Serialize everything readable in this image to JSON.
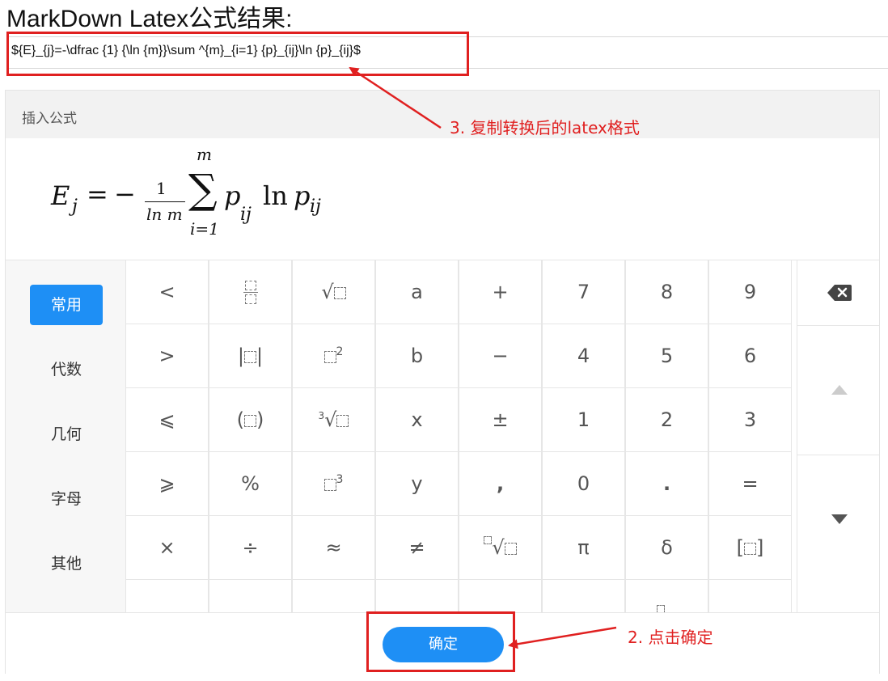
{
  "title": "MarkDown Latex公式结果:",
  "latex_value": "${E}_{j}=-\\dfrac {1} {\\ln {m}}\\sum ^{m}_{i=1} {p}_{ij}\\ln {p}_{ij}$",
  "panel": {
    "header": "插入公式",
    "formula": {
      "lhs": "E",
      "lhs_sub": "j",
      "eq": "=",
      "minus": "−",
      "frac_num": "1",
      "frac_den": "ln m",
      "sum_top": "m",
      "sum_bottom": "i=1",
      "p1": "p",
      "p1_sub": "ij",
      "ln": "ln",
      "p2": "p",
      "p2_sub": "ij"
    }
  },
  "categories": [
    "常用",
    "代数",
    "几何",
    "字母",
    "其他"
  ],
  "active_category": "常用",
  "keys": {
    "row1": [
      "<",
      "fraction",
      "sqrt",
      "a",
      "+",
      "7",
      "8",
      "9"
    ],
    "row2": [
      ">",
      "|□|",
      "□²",
      "b",
      "−",
      "4",
      "5",
      "6"
    ],
    "row3": [
      "⩽",
      "(□)",
      "∛□",
      "x",
      "±",
      "1",
      "2",
      "3"
    ],
    "row4": [
      "⩾",
      "%",
      "□³",
      "y",
      ",",
      "0",
      ".",
      "="
    ],
    "row5": [
      "×",
      "÷",
      "≈",
      "≠",
      "ⁿ√□",
      "π",
      "δ",
      "[□]"
    ]
  },
  "icons": {
    "backspace": "backspace-icon",
    "up": "arrow-up-icon",
    "down": "arrow-down-icon"
  },
  "confirm_label": "确定",
  "annotations": {
    "copy": "3. 复制转换后的latex格式",
    "click": "2. 点击确定"
  },
  "colors": {
    "accent": "#1e8ff5",
    "annotation_red": "#e02020"
  }
}
